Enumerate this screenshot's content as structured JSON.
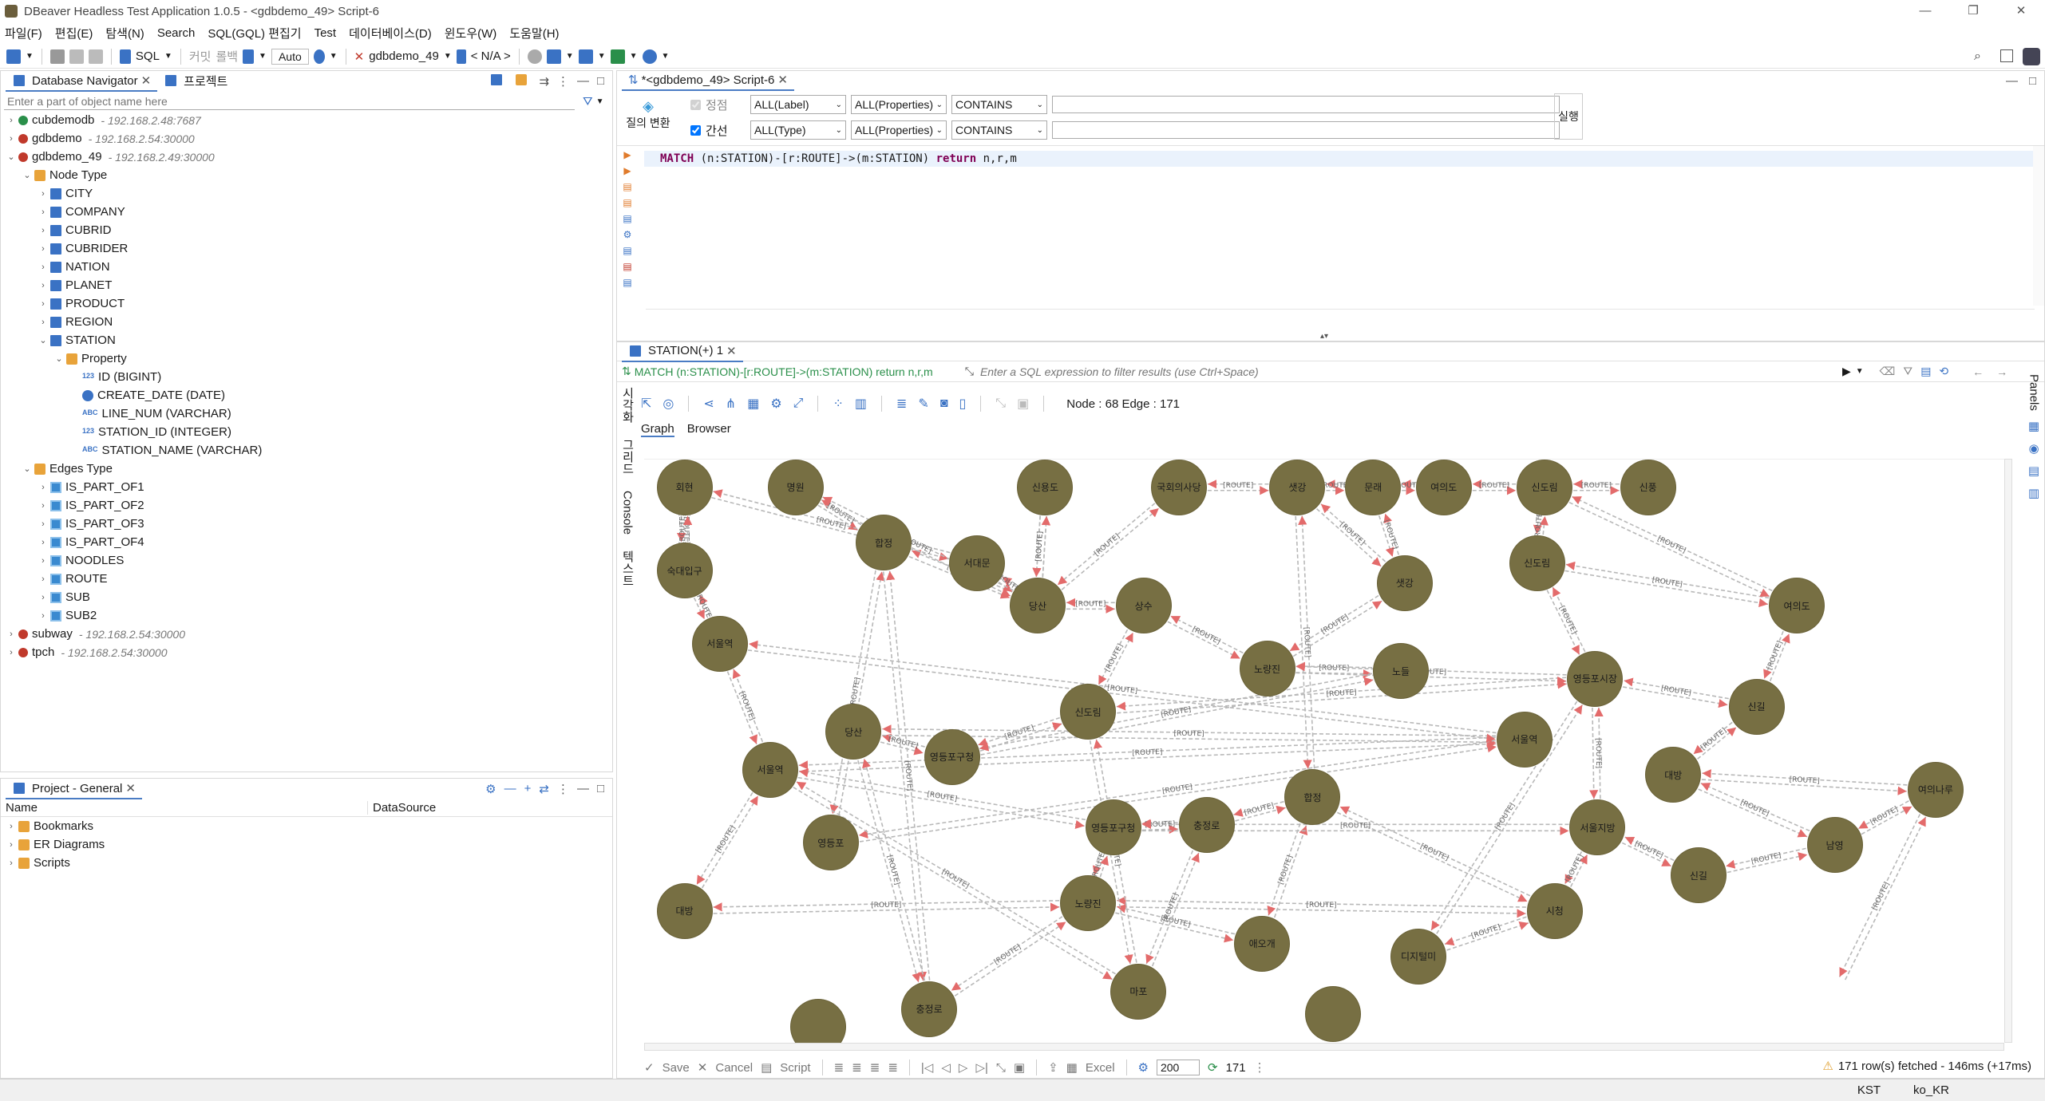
{
  "window": {
    "title": "DBeaver Headless Test Application 1.0.5 - <gdbdemo_49> Script-6"
  },
  "menu": [
    "파일(F)",
    "편집(E)",
    "탐색(N)",
    "Search",
    "SQL(GQL) 편집기",
    "Test",
    "데이터베이스(D)",
    "윈도우(W)",
    "도움말(H)"
  ],
  "toolbar": {
    "sql": "SQL",
    "commit": "커밋",
    "rollback": "롤백",
    "auto": "Auto",
    "connection": "gdbdemo_49",
    "schema": "< N/A >"
  },
  "navigator": {
    "tab_label": "Database Navigator",
    "project_tab": "프로젝트",
    "filter_placeholder": "Enter a part of object name here",
    "connections": [
      {
        "name": "cubdemodb",
        "host": "- 192.168.2.48:7687",
        "expanded": false
      },
      {
        "name": "gdbdemo",
        "host": "- 192.168.2.54:30000",
        "expanded": false
      },
      {
        "name": "gdbdemo_49",
        "host": "- 192.168.2.49:30000",
        "expanded": true
      }
    ],
    "node_type_label": "Node Type",
    "node_types": [
      "CITY",
      "COMPANY",
      "CUBRID",
      "CUBRIDER",
      "NATION",
      "PLANET",
      "PRODUCT",
      "REGION",
      "STATION"
    ],
    "property_label": "Property",
    "properties": [
      {
        "badge": "123",
        "label": "ID (BIGINT)"
      },
      {
        "badge": "",
        "label": "CREATE_DATE (DATE)"
      },
      {
        "badge": "ABC",
        "label": "LINE_NUM (VARCHAR)"
      },
      {
        "badge": "123",
        "label": "STATION_ID (INTEGER)"
      },
      {
        "badge": "ABC",
        "label": "STATION_NAME (VARCHAR)"
      }
    ],
    "edges_type_label": "Edges Type",
    "edge_types": [
      "IS_PART_OF1",
      "IS_PART_OF2",
      "IS_PART_OF3",
      "IS_PART_OF4",
      "NOODLES",
      "ROUTE",
      "SUB",
      "SUB2"
    ],
    "other_connections": [
      {
        "name": "subway",
        "host": "- 192.168.2.54:30000"
      },
      {
        "name": "tpch",
        "host": "- 192.168.2.54:30000"
      }
    ]
  },
  "project": {
    "tab_label": "Project - General",
    "col_name": "Name",
    "col_datasource": "DataSource",
    "items": [
      "Bookmarks",
      "ER Diagrams",
      "Scripts"
    ]
  },
  "editor": {
    "tab_label": "*<gdbdemo_49> Script-6",
    "filter": {
      "query_convert": "질의 변환",
      "vertex_label": "정점",
      "edge_label": "간선",
      "all_label": "ALL(Label)",
      "all_properties": "ALL(Properties)",
      "all_type": "ALL(Type)",
      "contains": "CONTAINS",
      "run": "실행"
    },
    "query_keyword1": "MATCH",
    "query_mid": " (n:STATION)-[r:ROUTE]->(m:STATION) ",
    "query_keyword2": "return",
    "query_tail": " n,r,m"
  },
  "results": {
    "tab_label": "STATION(+) 1",
    "query_text": "MATCH (n:STATION)-[r:ROUTE]->(m:STATION) return n,r,m",
    "filter_placeholder": "Enter a SQL expression to filter results (use Ctrl+Space)",
    "node_edge_count": "Node : 68 Edge : 171",
    "tab_graph": "Graph",
    "tab_browser": "Browser",
    "side_tabs": [
      "시각화",
      "그리드",
      "Console",
      "텍스트"
    ],
    "right_panel": "Panels",
    "save": "Save",
    "cancel": "Cancel",
    "script": "Script",
    "excel": "Excel",
    "fetch_size": "200",
    "row_count": "171",
    "fetched": "171 row(s) fetched - 146ms (+17ms)"
  },
  "graph": {
    "edge_label": "[ROUTE]",
    "nodes": [
      "회현",
      "명원",
      "신용도",
      "국회의사당",
      "샛강",
      "문래",
      "여의도",
      "신도림",
      "신풍",
      "숙대입구",
      "합정",
      "서대문",
      "당산",
      "상수",
      "샛강",
      "신도림",
      "여의도",
      "서울역",
      "노량진",
      "노들",
      "영등포시장",
      "신길",
      "서울역",
      "서울역",
      "당산",
      "영등포구청",
      "신도림",
      "대방",
      "여의나루",
      "영등포구청",
      "충정로",
      "합정",
      "영등포",
      "서울지방",
      "노량진",
      "신길",
      "남영",
      "대방",
      "시청",
      "애오개",
      "디지털미",
      "충정로",
      "마포"
    ]
  },
  "status": {
    "timezone": "KST",
    "locale": "ko_KR"
  }
}
